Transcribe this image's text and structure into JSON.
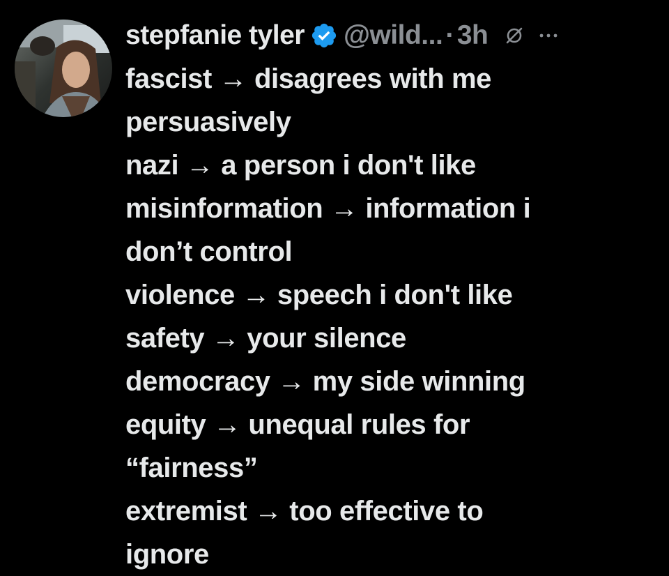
{
  "tweet": {
    "author": {
      "display_name": "stepfanie tyler",
      "handle": "@wild...",
      "verified": true,
      "avatar_icon": "profile-photo"
    },
    "separator": "·",
    "time": "3h",
    "header_icons": [
      "grok-icon",
      "more-icon"
    ],
    "body_lines": [
      "fascist → disagrees with me",
      "persuasively",
      "nazi → a person i don't like",
      "misinformation → information i",
      "don’t control",
      "violence → speech i don't like",
      "safety → your silence",
      "democracy → my side winning",
      "equity → unequal rules for",
      "“fairness”",
      "extremist → too effective to",
      "ignore"
    ]
  },
  "colors": {
    "background": "#000000",
    "text_primary": "#e7e9ea",
    "text_secondary": "#8b8f94",
    "verified_badge": "#1d9bf0"
  }
}
